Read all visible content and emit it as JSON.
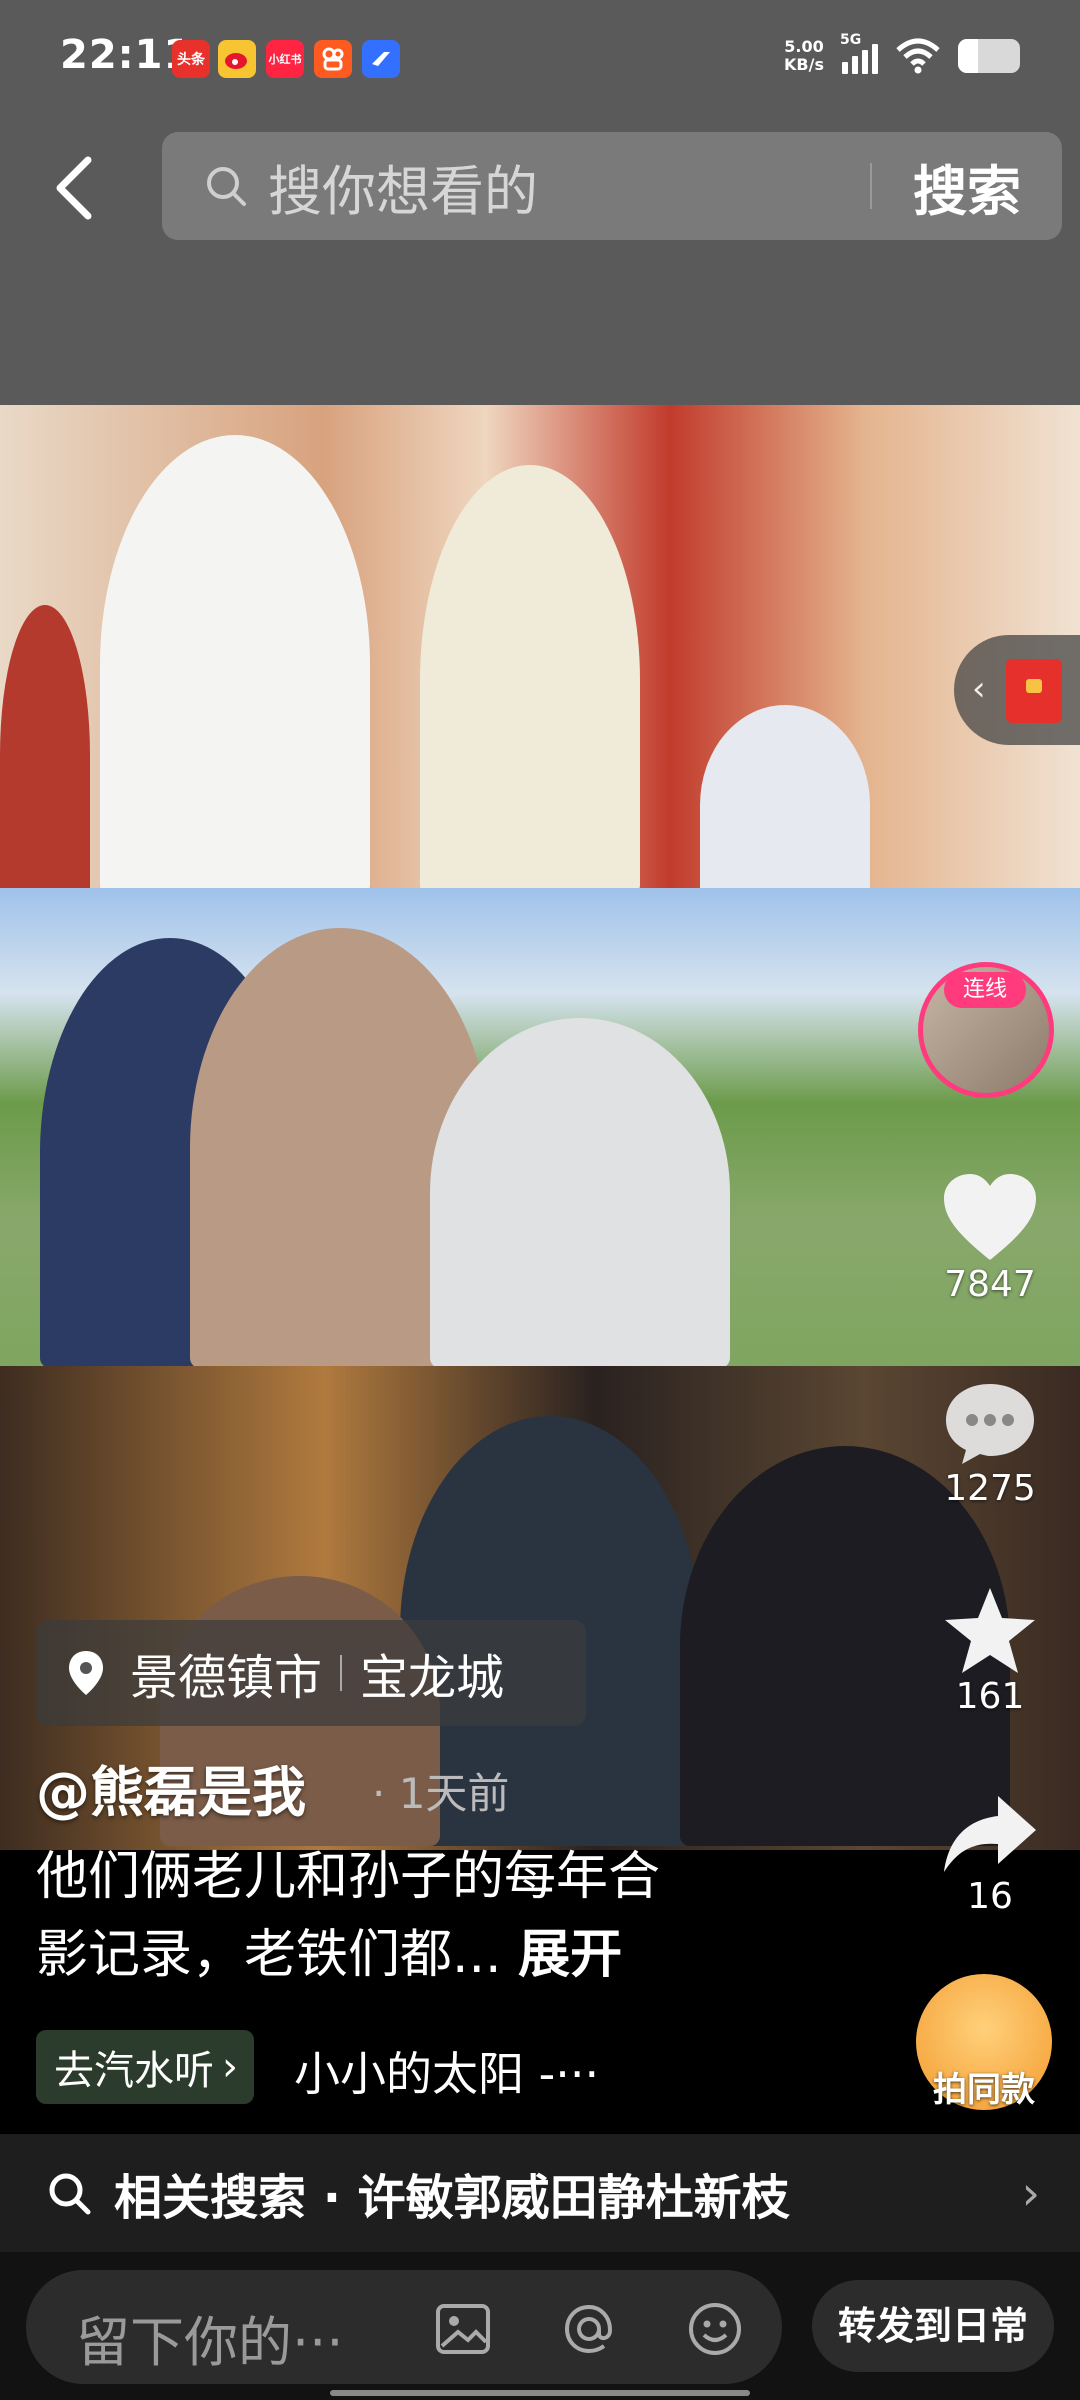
{
  "status_bar": {
    "time": "22:11",
    "net_speed_value": "5.00",
    "net_speed_unit": "KB/s",
    "network": "5G",
    "notification_apps": [
      {
        "icon": "toutiao-icon",
        "label": "头条",
        "color": "#e8312b"
      },
      {
        "icon": "weibo-icon",
        "label": "",
        "color": "#f7c531"
      },
      {
        "icon": "xiaohongshu-icon",
        "label": "小红书",
        "color": "#ff2442"
      },
      {
        "icon": "kuaishou-icon",
        "label": "",
        "color": "#ff5a1f"
      },
      {
        "icon": "feishu-icon",
        "label": "",
        "color": "#3370ff"
      }
    ]
  },
  "search": {
    "placeholder": "搜你想看的",
    "button_label": "搜索"
  },
  "live_badge": "连线",
  "actions": {
    "likes": "7847",
    "comments": "1275",
    "favorites": "161",
    "shares": "16"
  },
  "location": {
    "city": "景德镇市",
    "place": "宝龙城"
  },
  "post": {
    "author": "@熊磊是我",
    "time": "· 1天前",
    "caption_line1": "他们俩老儿和孙子的每年合",
    "caption_line2": "影记录，老铁们都...",
    "expand_label": "展开"
  },
  "music": {
    "chip_label": "去汽水听",
    "title": "小小的太阳 -···"
  },
  "same_style_label": "拍同款",
  "related": {
    "text": "相关搜索 · 许敏郭威田静杜新枝"
  },
  "bottom": {
    "comment_placeholder": "留下你的···",
    "share_daily_label": "转发到日常"
  },
  "colors": {
    "accent_pink": "#ff3b7d",
    "redpack": "#e5302c"
  }
}
